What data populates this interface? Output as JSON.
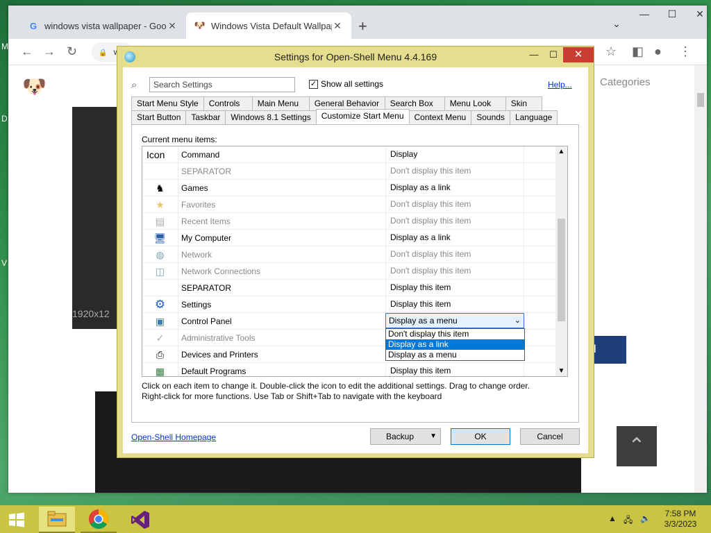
{
  "browser": {
    "tabs": [
      {
        "title": "windows vista wallpaper - Googl",
        "favicon": "google-g"
      },
      {
        "title": "Windows Vista Default Wallpape",
        "favicon": "dog-logo"
      }
    ],
    "omnibox_text": "w",
    "page_text": {
      "categories": "Categories",
      "dimensions": "1920x12",
      "download": "ad"
    }
  },
  "dialog": {
    "title": "Settings for Open-Shell Menu 4.4.169",
    "search_placeholder": "Search Settings",
    "show_all_label": "Show all settings",
    "show_all_checked": true,
    "help_label": "Help...",
    "tabs_row1": [
      "Start Menu Style",
      "Controls",
      "Main Menu",
      "General Behavior",
      "Search Box",
      "Menu Look",
      "Skin"
    ],
    "tabs_row2": [
      "Start Button",
      "Taskbar",
      "Windows 8.1 Settings",
      "Customize Start Menu",
      "Context Menu",
      "Sounds",
      "Language"
    ],
    "active_tab": "Customize Start Menu",
    "current_items_label": "Current menu items:",
    "columns": {
      "icon": "Icon",
      "command": "Command",
      "display": "Display"
    },
    "items": [
      {
        "icon": "none",
        "command": "SEPARATOR",
        "display": "Don't display this item",
        "hidden": true
      },
      {
        "icon": "games-icon",
        "command": "Games",
        "display": "Display as a link",
        "hidden": false
      },
      {
        "icon": "star-icon",
        "command": "Favorites",
        "display": "Don't display this item",
        "hidden": true
      },
      {
        "icon": "recent-items-icon",
        "command": "Recent Items",
        "display": "Don't display this item",
        "hidden": true
      },
      {
        "icon": "computer-icon",
        "command": "My Computer",
        "display": "Display as a link",
        "hidden": false
      },
      {
        "icon": "network-icon",
        "command": "Network",
        "display": "Don't display this item",
        "hidden": true
      },
      {
        "icon": "network-connections-icon",
        "command": "Network Connections",
        "display": "Don't display this item",
        "hidden": true
      },
      {
        "icon": "none",
        "command": "SEPARATOR",
        "display": "Display this item",
        "hidden": false
      },
      {
        "icon": "gear-icon",
        "command": "Settings",
        "display": "Display this item",
        "hidden": false
      },
      {
        "icon": "control-panel-icon",
        "command": "Control Panel",
        "display": "Display as a menu",
        "hidden": false
      },
      {
        "icon": "admin-tools-icon",
        "command": "Administrative Tools",
        "display": "",
        "hidden": true
      },
      {
        "icon": "printer-icon",
        "command": "Devices and Printers",
        "display": "",
        "hidden": false
      },
      {
        "icon": "default-programs-icon",
        "command": "Default Programs",
        "display": "Display this item",
        "hidden": false
      }
    ],
    "combo_value": "Display as a menu",
    "dropdown_options": [
      "Don't display this item",
      "Display as a link",
      "Display as a menu"
    ],
    "dropdown_selected": "Display as a link",
    "hint_line1": "Click on each item to change it. Double-click the icon to edit the additional settings. Drag to change order.",
    "hint_line2": "Right-click for more functions. Use Tab or Shift+Tab to navigate with the keyboard",
    "homepage_label": "Open-Shell Homepage",
    "backup_label": "Backup",
    "ok_label": "OK",
    "cancel_label": "Cancel"
  },
  "taskbar": {
    "time": "7:58 PM",
    "date": "3/3/2023",
    "pinned": [
      "file-explorer-icon",
      "chrome-icon",
      "visual-studio-icon"
    ]
  },
  "desktop_labels": [
    "M",
    "D",
    "V"
  ]
}
